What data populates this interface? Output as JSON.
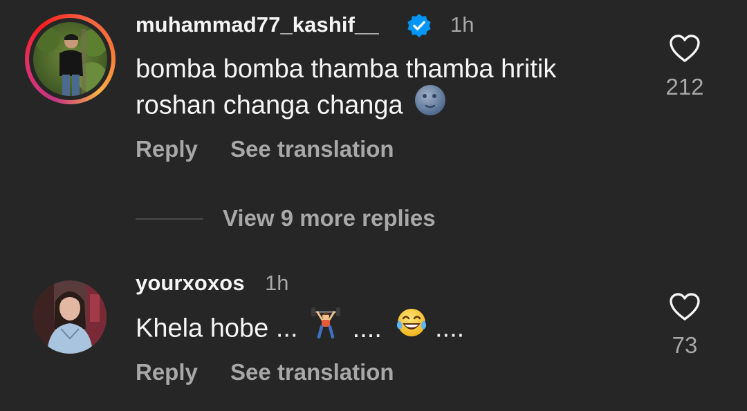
{
  "comments": [
    {
      "username": "muhammad77_kashif__",
      "verified": true,
      "time": "1h",
      "text_line1": "bomba bomba thamba thamba hritik",
      "text_line2": "roshan changa changa",
      "emoji": "new-moon-face",
      "reply_label": "Reply",
      "translate_label": "See translation",
      "likes": "212",
      "story_ring": true
    },
    {
      "username": "yourxoxos",
      "verified": false,
      "time": "1h",
      "text_part1": "Khela hobe ...",
      "text_part2": "....",
      "text_part3": "....",
      "emojis": [
        "weightlifter",
        "tears-of-joy"
      ],
      "reply_label": "Reply",
      "translate_label": "See translation",
      "likes": "73",
      "story_ring": false
    }
  ],
  "replies_toggle": {
    "label": "View 9 more replies"
  },
  "colors": {
    "background": "#262626",
    "primary_text": "#f5f5f5",
    "secondary_text": "#a8a8a8",
    "verified_blue": "#0095f6"
  }
}
